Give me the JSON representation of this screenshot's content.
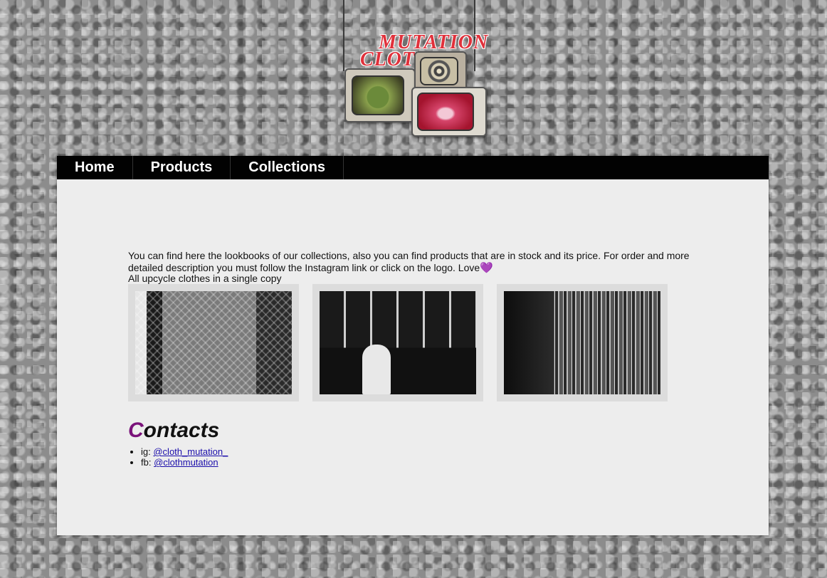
{
  "logo": {
    "line1": "MUTATION",
    "line2": "CLOTH"
  },
  "nav": {
    "items": [
      {
        "label": "Home"
      },
      {
        "label": "Products"
      },
      {
        "label": "Collections"
      }
    ]
  },
  "intro": {
    "text": "You can find here the lookbooks of our collections, also you can find products that are in stock and its price. For order and more detailed description you must follow the Instagram link or click on the logo. Love",
    "heart": "💜",
    "note": "All upcycle clothes in a single copy"
  },
  "contacts": {
    "heading_first": "C",
    "heading_rest": "ontacts",
    "items": [
      {
        "label": "ig:",
        "link": "@cloth_mutation_"
      },
      {
        "label": "fb:",
        "link": "@clothmutation"
      }
    ]
  },
  "colors": {
    "accent": "#7a127a",
    "nav_bg": "#020202",
    "panel_bg": "#ededed",
    "link": "#1a0dab"
  }
}
